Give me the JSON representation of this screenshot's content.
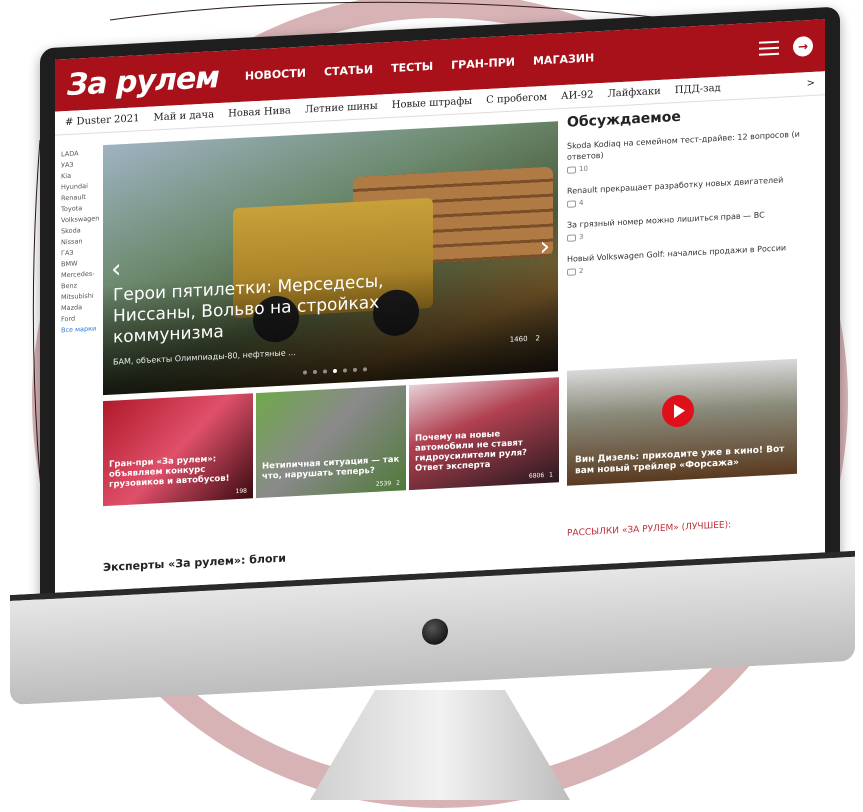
{
  "header": {
    "logo": "За рулем",
    "nav": [
      "НОВОСТИ",
      "СТАТЬИ",
      "ТЕСТЫ",
      "ГРАН-ПРИ",
      "МАГАЗИН"
    ]
  },
  "tags": [
    "# Duster 2021",
    "Май и дача",
    "Новая Нива",
    "Летние шины",
    "Новые штрафы",
    "С пробегом",
    "АИ-92",
    "Лайфхаки",
    "ПДД-зад"
  ],
  "tags_arrow": ">",
  "brands": [
    "LADA",
    "УАЗ",
    "Kia",
    "Hyundai",
    "Renault",
    "Toyota",
    "Volkswagen",
    "Skoda",
    "Nissan",
    "ГАЗ",
    "BMW",
    "Mercedes-Benz",
    "Mitsubishi",
    "Mazda",
    "Ford"
  ],
  "brands_all": "Все марки",
  "hero": {
    "title": "Герои пятилетки: Мерседесы, Ниссаны, Вольво на стройках коммунизма",
    "subtitle": "БАМ, объекты Олимпиады-80, нефтяные ...",
    "views": "1460",
    "comments": "2",
    "prev": "‹",
    "next": "›"
  },
  "discussed": {
    "title": "Обсуждаемое",
    "items": [
      {
        "text": "Skoda Kodiaq на семейном тест-драйве: 12 вопросов (и ответов)",
        "count": "10"
      },
      {
        "text": "Renault прекращает разработку новых двигателей",
        "count": "4"
      },
      {
        "text": "За грязный номер можно лишиться прав — ВС",
        "count": "3"
      },
      {
        "text": "Новый Volkswagen Golf: начались продажи в России",
        "count": "2"
      }
    ]
  },
  "tiles": [
    {
      "caption": "Гран-при «За рулем»: объявляем конкурс грузовиков и автобусов!",
      "views": "198",
      "comments": ""
    },
    {
      "caption": "Нетипичная ситуация — так что, нарушать теперь?",
      "views": "2539",
      "comments": "2"
    },
    {
      "caption": "Почему на новые автомобили не ставят гидроусилители руля? Ответ эксперта",
      "views": "6806",
      "comments": "1"
    }
  ],
  "video": {
    "caption": "Вин Дизель: приходите уже в кино! Вот вам новый трейлер «Форсажа»"
  },
  "experts_title": "Эксперты «За рулем»: блоги",
  "newsletter_title": "РАССЫЛКИ «ЗА РУЛЕМ» (ЛУЧШЕЕ):",
  "colors": {
    "brand_red": "#a8101a",
    "ring": "#c9a0a5"
  }
}
